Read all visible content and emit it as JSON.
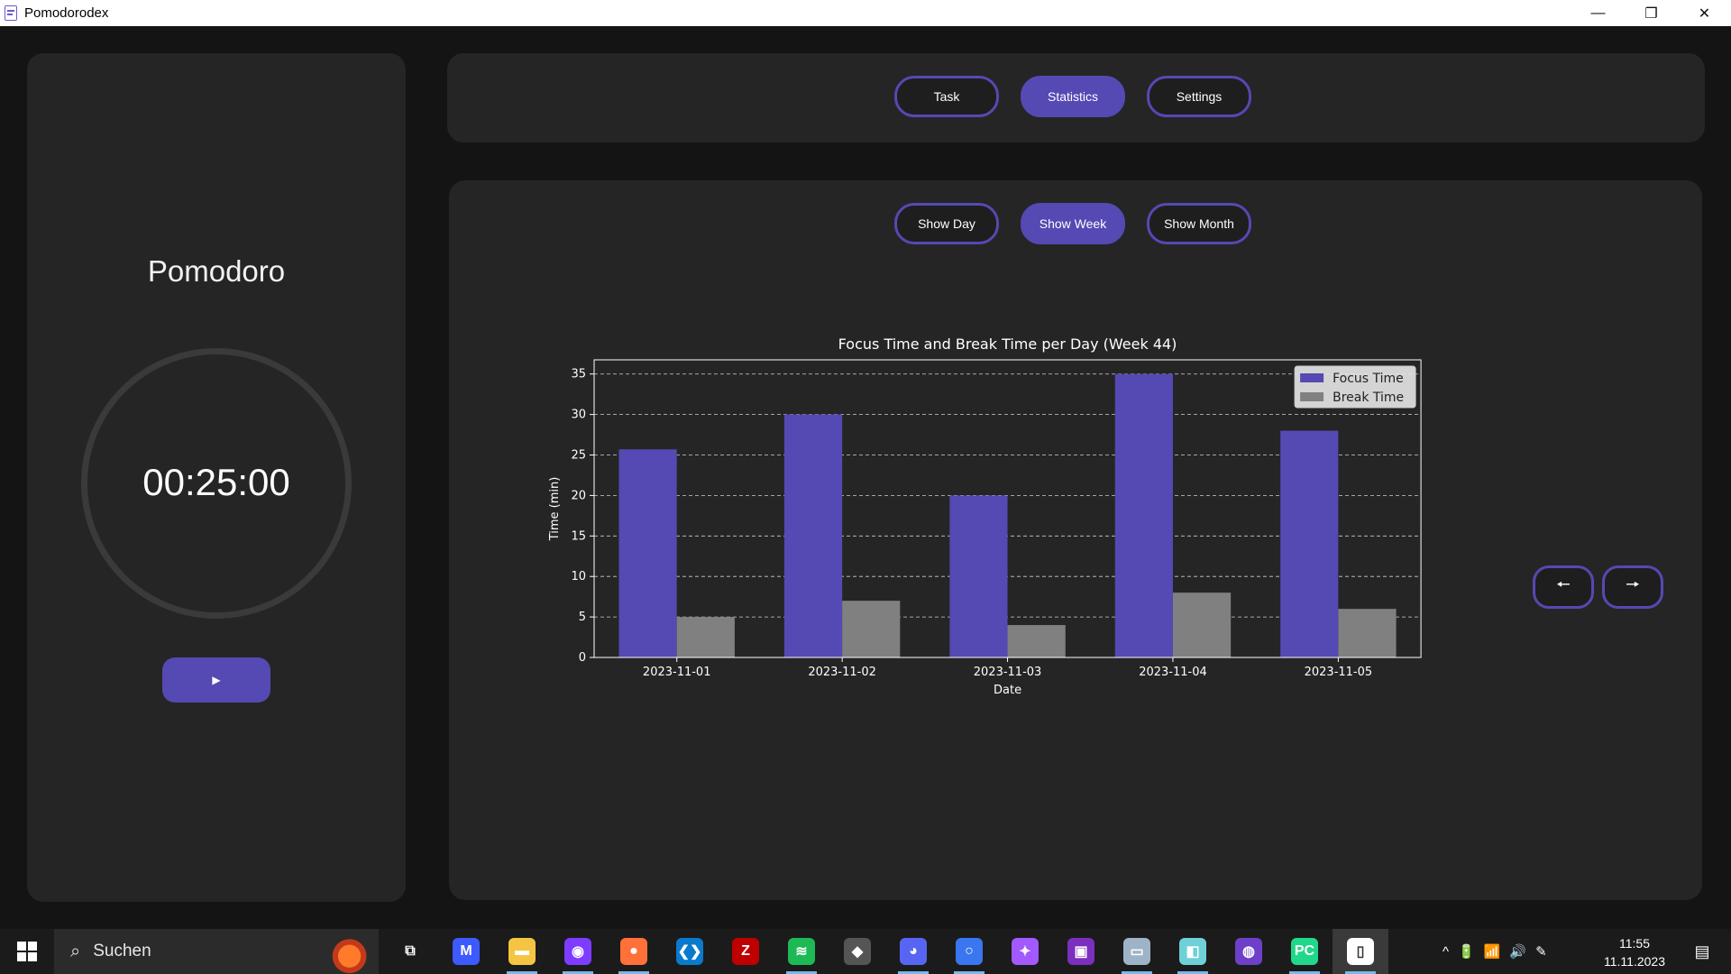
{
  "window": {
    "title": "Pomodorodex",
    "controls": [
      "—",
      "❐",
      "✕"
    ]
  },
  "pomodoro": {
    "title": "Pomodoro",
    "time": "00:25:00",
    "play_label": "▶"
  },
  "tabs": [
    {
      "label": "Task",
      "active": false
    },
    {
      "label": "Statistics",
      "active": true
    },
    {
      "label": "Settings",
      "active": false
    }
  ],
  "range_buttons": [
    {
      "label": "Show Day",
      "active": false
    },
    {
      "label": "Show Week",
      "active": true
    },
    {
      "label": "Show Month",
      "active": false
    }
  ],
  "nav": {
    "prev_label": "🠔",
    "next_label": "🠖"
  },
  "colors": {
    "accent": "#5549b3",
    "break": "#808080",
    "panel": "#252525",
    "background": "#141414"
  },
  "chart_data": {
    "type": "bar",
    "title": "Focus Time and Break Time per Day (Week 44)",
    "xlabel": "Date",
    "ylabel": "Time (min)",
    "categories": [
      "2023-11-01",
      "2023-11-02",
      "2023-11-03",
      "2023-11-04",
      "2023-11-05"
    ],
    "series": [
      {
        "name": "Focus Time",
        "values": [
          25.7,
          30,
          20,
          35,
          28
        ],
        "color": "#5549b3"
      },
      {
        "name": "Break Time",
        "values": [
          5,
          7,
          4,
          8,
          6
        ],
        "color": "#808080"
      }
    ],
    "ylim": [
      0,
      36.75
    ],
    "yticks": [
      0,
      5,
      10,
      15,
      20,
      25,
      30,
      35
    ],
    "grid": true,
    "legend": "top-right"
  },
  "taskbar": {
    "search_placeholder": "Suchen",
    "apps": [
      {
        "name": "task-view",
        "glyph": "⧉",
        "color": "#1b1b1b",
        "running": false,
        "active": false
      },
      {
        "name": "vs-app",
        "glyph": "M",
        "color": "#3d5afe",
        "running": false,
        "active": false
      },
      {
        "name": "file-explorer",
        "glyph": "▬",
        "color": "#f4c542",
        "running": true,
        "active": false
      },
      {
        "name": "tor-browser",
        "glyph": "◉",
        "color": "#7d3cff",
        "running": true,
        "active": false
      },
      {
        "name": "firefox",
        "glyph": "●",
        "color": "#ff7139",
        "running": true,
        "active": false
      },
      {
        "name": "vscode",
        "glyph": "❮❯",
        "color": "#0a7acc",
        "running": false,
        "active": false
      },
      {
        "name": "filezilla",
        "glyph": "Z",
        "color": "#bf0000",
        "running": false,
        "active": false
      },
      {
        "name": "spotify",
        "glyph": "≋",
        "color": "#1db954",
        "running": true,
        "active": false
      },
      {
        "name": "unity",
        "glyph": "◆",
        "color": "#555555",
        "running": false,
        "active": false
      },
      {
        "name": "discord",
        "glyph": "◕",
        "color": "#5865f2",
        "running": true,
        "active": false
      },
      {
        "name": "signal",
        "glyph": "○",
        "color": "#3a76f0",
        "running": true,
        "active": false
      },
      {
        "name": "figma",
        "glyph": "✦",
        "color": "#a259ff",
        "running": false,
        "active": false
      },
      {
        "name": "app-purple",
        "glyph": "▣",
        "color": "#7b2fbe",
        "running": false,
        "active": false
      },
      {
        "name": "remote-desktop",
        "glyph": "▭",
        "color": "#9fb3c8",
        "running": true,
        "active": false
      },
      {
        "name": "notepad",
        "glyph": "◧",
        "color": "#6fd0d8",
        "running": true,
        "active": false
      },
      {
        "name": "github",
        "glyph": "◍",
        "color": "#6e40c9",
        "running": false,
        "active": false
      },
      {
        "name": "pycharm",
        "glyph": "PC",
        "color": "#21d789",
        "running": true,
        "active": false
      },
      {
        "name": "pomodorodex-app",
        "glyph": "▯",
        "color": "#ffffff",
        "running": true,
        "active": true
      }
    ],
    "tray_icons": [
      "^",
      "🔋",
      "📶",
      "🔊",
      "✎"
    ],
    "time": "11:55",
    "date": "11.11.2023",
    "notification_icon": "▤"
  }
}
